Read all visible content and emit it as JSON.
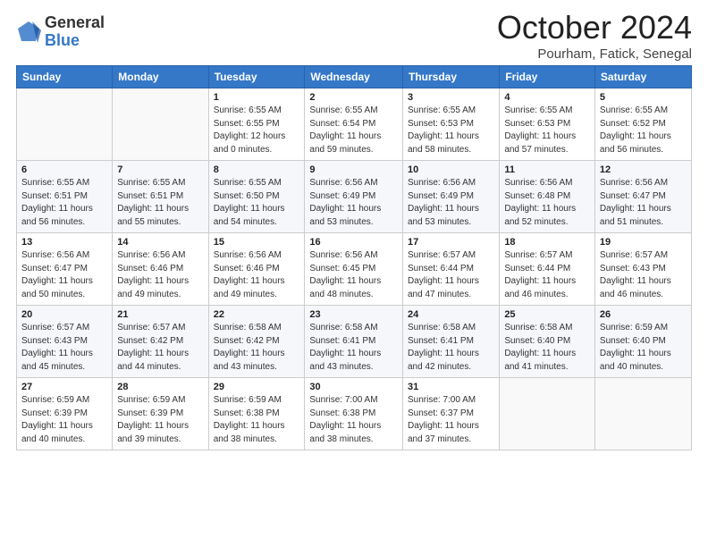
{
  "header": {
    "logo_general": "General",
    "logo_blue": "Blue",
    "month_title": "October 2024",
    "location": "Pourham, Fatick, Senegal"
  },
  "weekdays": [
    "Sunday",
    "Monday",
    "Tuesday",
    "Wednesday",
    "Thursday",
    "Friday",
    "Saturday"
  ],
  "weeks": [
    [
      {
        "day": "",
        "info": ""
      },
      {
        "day": "",
        "info": ""
      },
      {
        "day": "1",
        "info": "Sunrise: 6:55 AM\nSunset: 6:55 PM\nDaylight: 12 hours\nand 0 minutes."
      },
      {
        "day": "2",
        "info": "Sunrise: 6:55 AM\nSunset: 6:54 PM\nDaylight: 11 hours\nand 59 minutes."
      },
      {
        "day": "3",
        "info": "Sunrise: 6:55 AM\nSunset: 6:53 PM\nDaylight: 11 hours\nand 58 minutes."
      },
      {
        "day": "4",
        "info": "Sunrise: 6:55 AM\nSunset: 6:53 PM\nDaylight: 11 hours\nand 57 minutes."
      },
      {
        "day": "5",
        "info": "Sunrise: 6:55 AM\nSunset: 6:52 PM\nDaylight: 11 hours\nand 56 minutes."
      }
    ],
    [
      {
        "day": "6",
        "info": "Sunrise: 6:55 AM\nSunset: 6:51 PM\nDaylight: 11 hours\nand 56 minutes."
      },
      {
        "day": "7",
        "info": "Sunrise: 6:55 AM\nSunset: 6:51 PM\nDaylight: 11 hours\nand 55 minutes."
      },
      {
        "day": "8",
        "info": "Sunrise: 6:55 AM\nSunset: 6:50 PM\nDaylight: 11 hours\nand 54 minutes."
      },
      {
        "day": "9",
        "info": "Sunrise: 6:56 AM\nSunset: 6:49 PM\nDaylight: 11 hours\nand 53 minutes."
      },
      {
        "day": "10",
        "info": "Sunrise: 6:56 AM\nSunset: 6:49 PM\nDaylight: 11 hours\nand 53 minutes."
      },
      {
        "day": "11",
        "info": "Sunrise: 6:56 AM\nSunset: 6:48 PM\nDaylight: 11 hours\nand 52 minutes."
      },
      {
        "day": "12",
        "info": "Sunrise: 6:56 AM\nSunset: 6:47 PM\nDaylight: 11 hours\nand 51 minutes."
      }
    ],
    [
      {
        "day": "13",
        "info": "Sunrise: 6:56 AM\nSunset: 6:47 PM\nDaylight: 11 hours\nand 50 minutes."
      },
      {
        "day": "14",
        "info": "Sunrise: 6:56 AM\nSunset: 6:46 PM\nDaylight: 11 hours\nand 49 minutes."
      },
      {
        "day": "15",
        "info": "Sunrise: 6:56 AM\nSunset: 6:46 PM\nDaylight: 11 hours\nand 49 minutes."
      },
      {
        "day": "16",
        "info": "Sunrise: 6:56 AM\nSunset: 6:45 PM\nDaylight: 11 hours\nand 48 minutes."
      },
      {
        "day": "17",
        "info": "Sunrise: 6:57 AM\nSunset: 6:44 PM\nDaylight: 11 hours\nand 47 minutes."
      },
      {
        "day": "18",
        "info": "Sunrise: 6:57 AM\nSunset: 6:44 PM\nDaylight: 11 hours\nand 46 minutes."
      },
      {
        "day": "19",
        "info": "Sunrise: 6:57 AM\nSunset: 6:43 PM\nDaylight: 11 hours\nand 46 minutes."
      }
    ],
    [
      {
        "day": "20",
        "info": "Sunrise: 6:57 AM\nSunset: 6:43 PM\nDaylight: 11 hours\nand 45 minutes."
      },
      {
        "day": "21",
        "info": "Sunrise: 6:57 AM\nSunset: 6:42 PM\nDaylight: 11 hours\nand 44 minutes."
      },
      {
        "day": "22",
        "info": "Sunrise: 6:58 AM\nSunset: 6:42 PM\nDaylight: 11 hours\nand 43 minutes."
      },
      {
        "day": "23",
        "info": "Sunrise: 6:58 AM\nSunset: 6:41 PM\nDaylight: 11 hours\nand 43 minutes."
      },
      {
        "day": "24",
        "info": "Sunrise: 6:58 AM\nSunset: 6:41 PM\nDaylight: 11 hours\nand 42 minutes."
      },
      {
        "day": "25",
        "info": "Sunrise: 6:58 AM\nSunset: 6:40 PM\nDaylight: 11 hours\nand 41 minutes."
      },
      {
        "day": "26",
        "info": "Sunrise: 6:59 AM\nSunset: 6:40 PM\nDaylight: 11 hours\nand 40 minutes."
      }
    ],
    [
      {
        "day": "27",
        "info": "Sunrise: 6:59 AM\nSunset: 6:39 PM\nDaylight: 11 hours\nand 40 minutes."
      },
      {
        "day": "28",
        "info": "Sunrise: 6:59 AM\nSunset: 6:39 PM\nDaylight: 11 hours\nand 39 minutes."
      },
      {
        "day": "29",
        "info": "Sunrise: 6:59 AM\nSunset: 6:38 PM\nDaylight: 11 hours\nand 38 minutes."
      },
      {
        "day": "30",
        "info": "Sunrise: 7:00 AM\nSunset: 6:38 PM\nDaylight: 11 hours\nand 38 minutes."
      },
      {
        "day": "31",
        "info": "Sunrise: 7:00 AM\nSunset: 6:37 PM\nDaylight: 11 hours\nand 37 minutes."
      },
      {
        "day": "",
        "info": ""
      },
      {
        "day": "",
        "info": ""
      }
    ]
  ]
}
